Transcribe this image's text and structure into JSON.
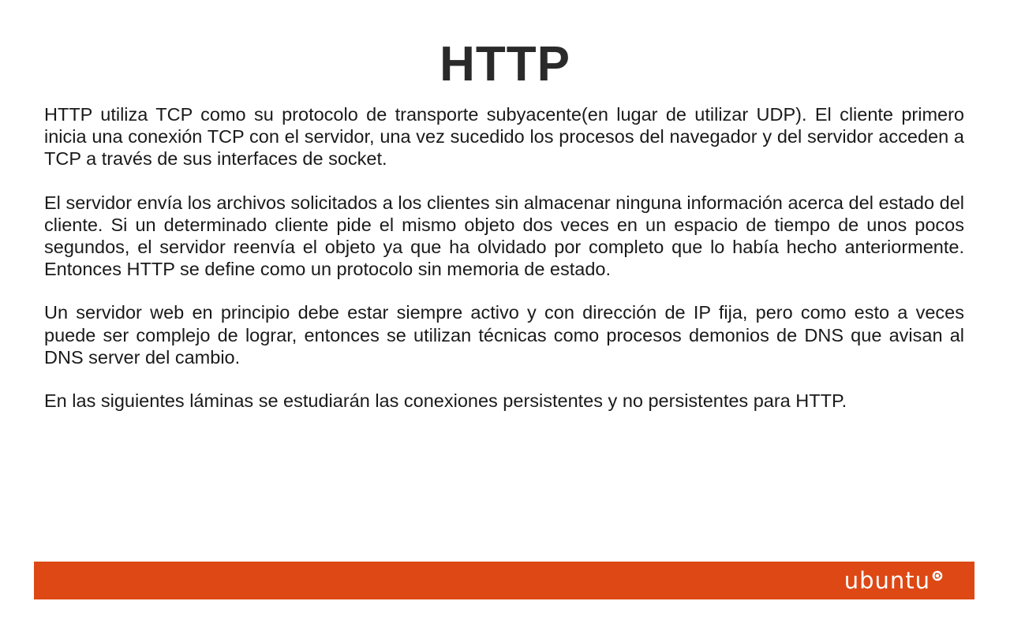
{
  "slide": {
    "title": "HTTP",
    "paragraphs": [
      "HTTP utiliza TCP como su protocolo de transporte subyacente(en lugar de utilizar UDP). El cliente primero inicia una conexión TCP con el servidor, una vez sucedido los procesos del navegador y del servidor acceden a TCP a través de sus interfaces de socket.",
      "El servidor envía los archivos solicitados a los clientes sin almacenar ninguna información acerca del estado del cliente. Si un determinado cliente pide el mismo objeto dos veces en un espacio de tiempo de unos pocos segundos, el servidor reenvía el objeto ya que ha olvidado por completo que lo había hecho anteriormente. Entonces HTTP se define como un protocolo sin memoria de estado.",
      "Un servidor web en principio debe estar siempre activo y con dirección de IP fija, pero como esto a veces puede ser complejo de lograr, entonces se utilizan técnicas como procesos demonios de DNS que avisan al DNS server del cambio.",
      "En las siguientes láminas se estudiarán las conexiones persistentes y no persistentes para HTTP."
    ]
  },
  "footer": {
    "logo_text": "ubuntu",
    "logo_icon": "ubuntu-circle-of-friends-icon",
    "bar_color": "#dd4814"
  }
}
